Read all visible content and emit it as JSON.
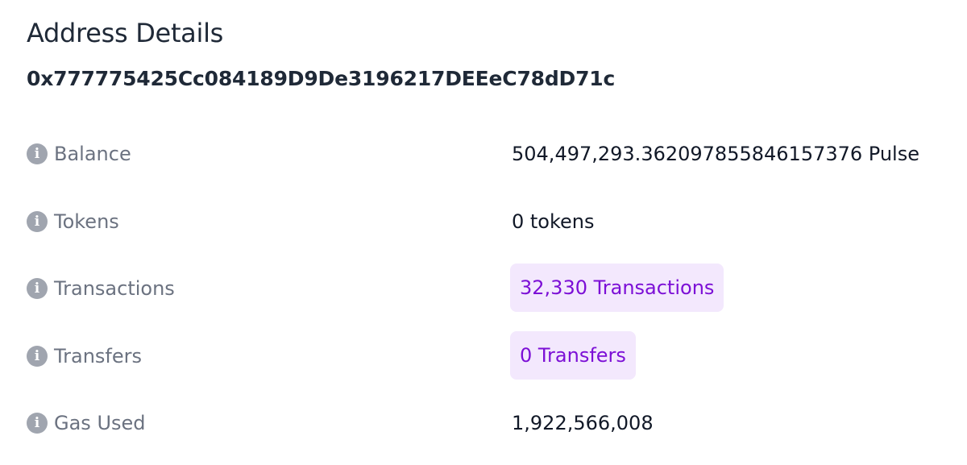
{
  "header": {
    "title": "Address Details",
    "address": "0x777775425Cc084189D9De3196217DEEeC78dD71c"
  },
  "rows": [
    {
      "label": "Balance",
      "value": "504,497,293.362097855846157376 Pulse",
      "icon": "info-icon"
    },
    {
      "label": "Tokens",
      "value": "0 tokens",
      "icon": "info-icon"
    },
    {
      "label": "Transactions",
      "value": "32,330 Transactions",
      "icon": "info-icon",
      "link": true
    },
    {
      "label": "Transfers",
      "value": "0 Transfers",
      "icon": "info-icon",
      "link": true
    },
    {
      "label": "Gas Used",
      "value": "1,922,566,008",
      "icon": "info-icon"
    }
  ],
  "colors": {
    "link_text": "#7c0fd6",
    "link_background": "#f3e8fd",
    "icon": "#a0a5af",
    "label": "#6b7280"
  }
}
